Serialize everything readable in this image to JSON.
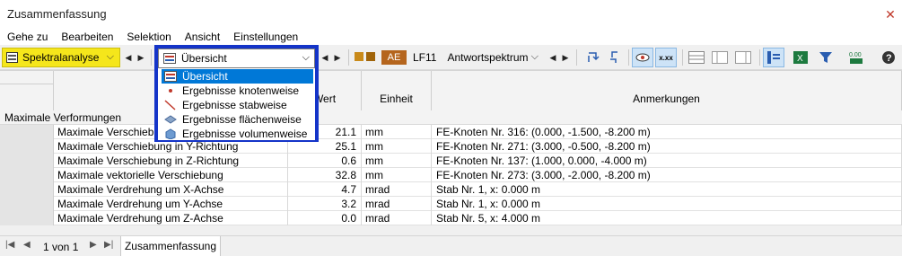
{
  "window": {
    "title": "Zusammenfassung",
    "close_glyph": "✕"
  },
  "menu": [
    "Gehe zu",
    "Bearbeiten",
    "Selektion",
    "Ansicht",
    "Einstellungen"
  ],
  "toolbar": {
    "analysis_combo": "Spektralanalyse",
    "view_combo": "Übersicht",
    "loadcase_tag": "AE",
    "loadcase_id": "LF11",
    "loadcase_name": "Antwortspektrum",
    "colors": {
      "analysis": "#f5e61b",
      "swatch1": "#c98a1a",
      "swatch2": "#a0640a",
      "tag": "#b5651d"
    },
    "icons": [
      "arrows-cycle-icon",
      "arrows-swap-icon",
      "eye-results-icon",
      "xxx-values-icon",
      "table-rows-icon",
      "table-export-icon",
      "table-import-icon",
      "column-filter-icon",
      "excel-icon",
      "funnel-icon",
      "numbers-icon",
      "help-icon"
    ]
  },
  "dropdown": {
    "items": [
      {
        "label": "Übersicht",
        "icon": "overview-icon"
      },
      {
        "label": "Ergebnisse knotenweise",
        "icon": "node-icon"
      },
      {
        "label": "Ergebnisse stabweise",
        "icon": "member-icon"
      },
      {
        "label": "Ergebnisse flächenweise",
        "icon": "surface-icon"
      },
      {
        "label": "Ergebnisse volumenweise",
        "icon": "solid-icon"
      }
    ],
    "selected_index": 0
  },
  "table": {
    "headers": {
      "value": "Wert",
      "unit": "Einheit",
      "notes": "Anmerkungen"
    },
    "group_label": "Maximale Verformungen",
    "rows": [
      {
        "desc": "Maximale Verschiebung in X-Richtung",
        "value": "21.1",
        "unit": "mm",
        "note": "FE-Knoten Nr. 316: (0.000, -1.500, -8.200 m)"
      },
      {
        "desc": "Maximale Verschiebung in Y-Richtung",
        "value": "25.1",
        "unit": "mm",
        "note": "FE-Knoten Nr. 271: (3.000, -0.500, -8.200 m)"
      },
      {
        "desc": "Maximale Verschiebung in Z-Richtung",
        "value": "0.6",
        "unit": "mm",
        "note": "FE-Knoten Nr. 137: (1.000, 0.000, -4.000 m)"
      },
      {
        "desc": "Maximale vektorielle Verschiebung",
        "value": "32.8",
        "unit": "mm",
        "note": "FE-Knoten Nr. 273: (3.000, -2.000, -8.200 m)"
      },
      {
        "desc": "Maximale Verdrehung um X-Achse",
        "value": "4.7",
        "unit": "mrad",
        "note": "Stab Nr. 1, x: 0.000 m"
      },
      {
        "desc": "Maximale Verdrehung um Y-Achse",
        "value": "3.2",
        "unit": "mrad",
        "note": "Stab Nr. 1, x: 0.000 m"
      },
      {
        "desc": "Maximale Verdrehung um Z-Achse",
        "value": "0.0",
        "unit": "mrad",
        "note": "Stab Nr. 5, x: 4.000 m"
      }
    ]
  },
  "footer": {
    "page_info": "1 von 1",
    "sheet_tab": "Zusammenfassung"
  }
}
